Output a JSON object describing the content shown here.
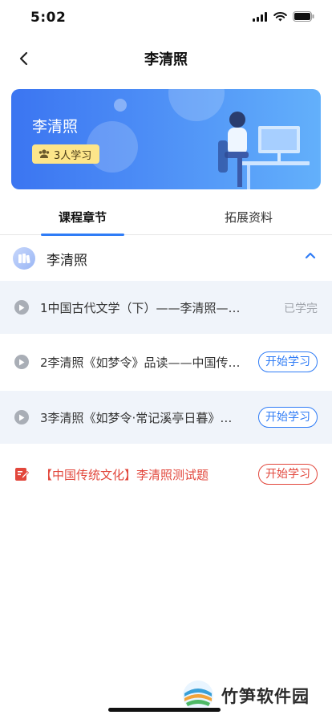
{
  "status_bar": {
    "time": "5:02",
    "icons": [
      "signal-icon",
      "wifi-icon",
      "battery-icon"
    ]
  },
  "nav": {
    "title": "李清照",
    "back_icon": "chevron-left-icon"
  },
  "banner": {
    "title": "李清照",
    "learners": "3人学习",
    "gradient_start": "#3b75f1",
    "gradient_end": "#63b0fb",
    "badge_color": "#fde58a"
  },
  "tabs": [
    {
      "label": "课程章节",
      "active": true
    },
    {
      "label": "拓展资料",
      "active": false
    }
  ],
  "section": {
    "title": "李清照",
    "expanded": true
  },
  "lessons": [
    {
      "index": 1,
      "title": "1中国古代文学（下）——李清照——中国…",
      "status": "已学完",
      "action": ""
    },
    {
      "index": 2,
      "title": "2李清照《如梦令》品读——中国传…",
      "status": "",
      "action": "开始学习"
    },
    {
      "index": 3,
      "title": "3李清照《如梦令·常记溪亭日暮》…",
      "status": "",
      "action": "开始学习"
    }
  ],
  "quiz": {
    "title": "【中国传统文化】李清照测试题",
    "action": "开始学习",
    "color": "#e2473c"
  },
  "watermark": {
    "text": "竹笋软件园"
  },
  "colors": {
    "accent": "#2f7cf6",
    "danger": "#e2473c",
    "row_shade": "#f0f4fa"
  }
}
